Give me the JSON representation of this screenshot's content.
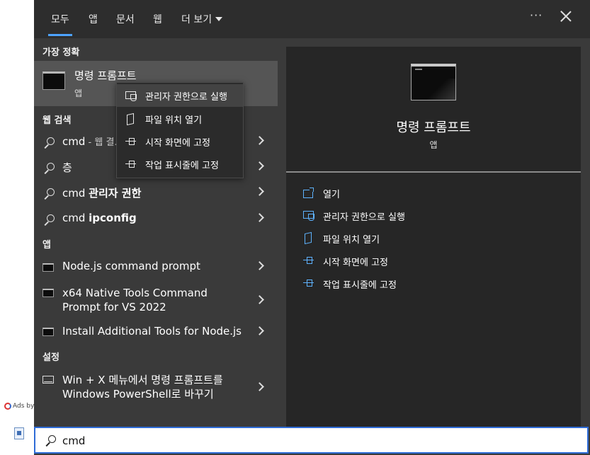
{
  "background": {
    "ads_text": "Ads by"
  },
  "tabs": [
    {
      "label": "모두",
      "active": true
    },
    {
      "label": "앱"
    },
    {
      "label": "문서"
    },
    {
      "label": "웹"
    },
    {
      "label": "더 보기"
    }
  ],
  "header": {
    "more_options": "···"
  },
  "left": {
    "best_match_title": "가장 정확",
    "best_match": {
      "name": "명령 프롬프트",
      "type": "앱",
      "icon": "cmd-icon"
    },
    "web_title": "웹 검색",
    "web_results": [
      {
        "plain": "cmd",
        "dim": " - 웹 결..."
      },
      {
        "plain": "층"
      },
      {
        "plain": "cmd ",
        "bold": "관리자 권한"
      },
      {
        "plain": "cmd ",
        "bold": "ipconfig"
      }
    ],
    "apps_title": "앱",
    "apps": [
      {
        "label": "Node.js command prompt"
      },
      {
        "label": "x64 Native Tools Command Prompt for VS 2022"
      },
      {
        "label": "Install Additional Tools for Node.js"
      }
    ],
    "settings_title": "설정",
    "settings": [
      {
        "label": "Win + X 메뉴에서 명령 프롬프트를 Windows PowerShell로 바꾸기"
      }
    ]
  },
  "context_menu": [
    {
      "label": "관리자 권한으로 실행",
      "icon": "admin-shield-icon"
    },
    {
      "label": "파일 위치 열기",
      "icon": "file-location-icon"
    },
    {
      "label": "시작 화면에 고정",
      "icon": "pin-icon"
    },
    {
      "label": "작업 표시줄에 고정",
      "icon": "pin-icon"
    }
  ],
  "detail": {
    "name": "명령 프롬프트",
    "type": "앱",
    "actions": [
      {
        "label": "열기",
        "icon": "open-icon"
      },
      {
        "label": "관리자 권한으로 실행",
        "icon": "admin-shield-icon"
      },
      {
        "label": "파일 위치 열기",
        "icon": "file-location-icon"
      },
      {
        "label": "시작 화면에 고정",
        "icon": "pin-icon"
      },
      {
        "label": "작업 표시줄에 고정",
        "icon": "pin-icon"
      }
    ]
  },
  "search": {
    "value": "cmd"
  },
  "colors": {
    "accent": "#4da3ff",
    "search_border": "#2e6bd6",
    "action_icon": "#5eb3ff"
  }
}
